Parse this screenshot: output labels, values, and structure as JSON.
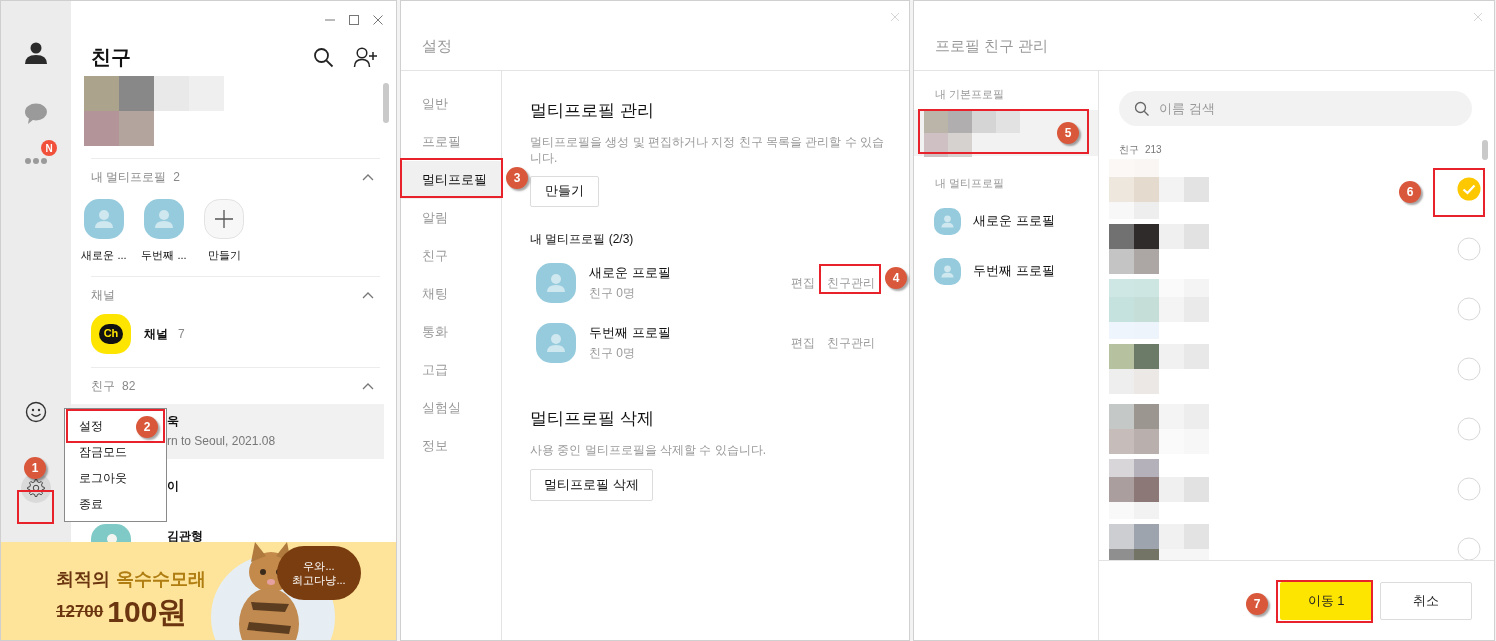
{
  "friends_window": {
    "more_badge": "N",
    "title": "친구",
    "sections": [
      {
        "kind": "multiprofile",
        "title": "내 멀티프로필",
        "count": "2",
        "expanded": true,
        "items": [
          {
            "kind": "avatar",
            "label": "새로운 ..."
          },
          {
            "kind": "avatar",
            "label": "두번째 ..."
          },
          {
            "kind": "add",
            "label": "만들기"
          }
        ]
      },
      {
        "kind": "channel",
        "title": "채널",
        "expanded": true,
        "items": [
          {
            "icon_text": "Ch",
            "name": "채널",
            "count": "7"
          }
        ]
      },
      {
        "kind": "friends",
        "title": "친구",
        "count": "82",
        "expanded": true,
        "items": [
          {
            "name": "욱",
            "status": "rn to Seoul, 2021.08",
            "selected": true
          },
          {
            "name": "이",
            "selected": false
          },
          {
            "name": "김관형",
            "selected": false
          }
        ]
      }
    ],
    "menu": [
      "설정",
      "잠금모드",
      "로그아웃",
      "종료"
    ],
    "banner": {
      "headline_1": "최적의",
      "headline_2": "옥수수모래",
      "old_price": "12700",
      "price": "100원",
      "bubble_1": "우와...",
      "bubble_2": "최고다냥..."
    }
  },
  "settings_window": {
    "title": "설정",
    "nav": [
      {
        "label": "일반",
        "selected": false
      },
      {
        "label": "프로필",
        "selected": false
      },
      {
        "label": "멀티프로필",
        "selected": true
      },
      {
        "label": "알림",
        "selected": false
      },
      {
        "label": "친구",
        "selected": false
      },
      {
        "label": "채팅",
        "selected": false
      },
      {
        "label": "통화",
        "selected": false
      },
      {
        "label": "고급",
        "selected": false
      },
      {
        "label": "실험실",
        "selected": false
      },
      {
        "label": "정보",
        "selected": false
      }
    ],
    "manage_heading": "멀티프로필 관리",
    "manage_description": "멀티프로필을 생성 및 편집하거나 지정 친구 목록을 관리할 수 있습니다.",
    "create_button": "만들기",
    "list_heading": "내 멀티프로필 (2/3)",
    "profiles": [
      {
        "name": "새로운 프로필",
        "friends": "친구 0명",
        "edit": "편집",
        "manage": "친구관리"
      },
      {
        "name": "두번째 프로필",
        "friends": "친구 0명",
        "edit": "편집",
        "manage": "친구관리"
      }
    ],
    "delete_heading": "멀티프로필 삭제",
    "delete_description": "사용 중인 멀티프로필을 삭제할 수 있습니다.",
    "delete_button": "멀티프로필 삭제"
  },
  "profile_friends_window": {
    "title": "프로필 친구 관리",
    "basic_heading": "내 기본프로필",
    "multi_heading": "내 멀티프로필",
    "multi_profiles": [
      {
        "name": "새로운 프로필",
        "selected": false
      },
      {
        "name": "두번째 프로필",
        "selected": false
      }
    ],
    "search": {
      "placeholder": "이름 검색"
    },
    "friends_label": "친구",
    "friends_count": "213",
    "friends": [
      {
        "checked": true
      },
      {
        "checked": false
      },
      {
        "checked": false
      },
      {
        "checked": false
      },
      {
        "checked": false
      },
      {
        "checked": false
      },
      {
        "checked": false
      }
    ],
    "move_button": "이동 1",
    "cancel_button": "취소"
  },
  "annotations": [
    "1",
    "2",
    "3",
    "4",
    "5",
    "6",
    "7"
  ]
}
